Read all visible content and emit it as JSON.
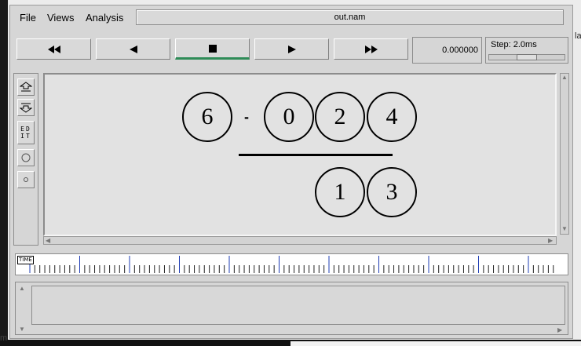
{
  "window": {
    "filename": "out.nam"
  },
  "menu": {
    "file": "File",
    "views": "Views",
    "analysis": "Analysis"
  },
  "toolbar": {
    "rewind_icon": "fast-rewind-icon",
    "back_icon": "play-backward-icon",
    "stop_icon": "stop-icon",
    "play_icon": "play-forward-icon",
    "ff_icon": "fast-forward-icon",
    "active_button": "stop",
    "active_color": "#2e8b57",
    "current_time": "0.000000",
    "step_label": "Step: 2.0ms",
    "step_slider_fraction": 0.5
  },
  "tools": {
    "zoom_in_icon": "zoom-in-icon",
    "zoom_out_icon": "zoom-out-icon",
    "edit_label_line1": "ED",
    "edit_label_line2": "IT",
    "circle_large_icon": "circle-icon",
    "circle_small_icon": "small-circle-icon"
  },
  "nodes": [
    {
      "id": "6"
    },
    {
      "id": "0"
    },
    {
      "id": "2"
    },
    {
      "id": "4"
    },
    {
      "id": "1"
    },
    {
      "id": "3"
    }
  ],
  "link_label": "-",
  "timeline": {
    "label": "TIME"
  },
  "background": {
    "bottom_left_text": "m",
    "right_edge_text": "la"
  }
}
